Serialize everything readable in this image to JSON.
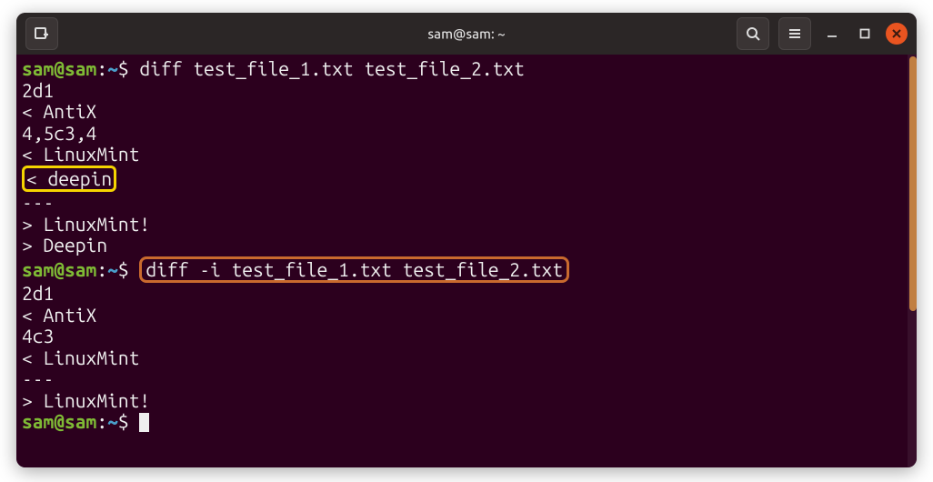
{
  "window": {
    "title": "sam@sam: ~"
  },
  "colors": {
    "bg": "#2c001e",
    "titlebar": "#2b2626",
    "close": "#e95420",
    "prompt_user": "#7fba35",
    "prompt_path": "#4aa0cc",
    "scrollbar": "#c17f41",
    "highlight_yellow": "#f5d400",
    "highlight_orange": "#c96a2e"
  },
  "prompt": {
    "user_host": "sam@sam",
    "sep": ":",
    "path": "~",
    "symbol": "$"
  },
  "session": {
    "cmd1": "diff test_file_1.txt test_file_2.txt",
    "out1": {
      "l1": "2d1",
      "l2": "< AntiX",
      "l3": "4,5c3,4",
      "l4": "< LinuxMint",
      "l5": "< deepin",
      "l6": "---",
      "l7": "> LinuxMint!",
      "l8": "> Deepin"
    },
    "cmd2": "diff -i test_file_1.txt test_file_2.txt",
    "out2": {
      "l1": "2d1",
      "l2": "< AntiX",
      "l3": "4c3",
      "l4": "< LinuxMint",
      "l5": "---",
      "l6": "> LinuxMint!"
    }
  }
}
